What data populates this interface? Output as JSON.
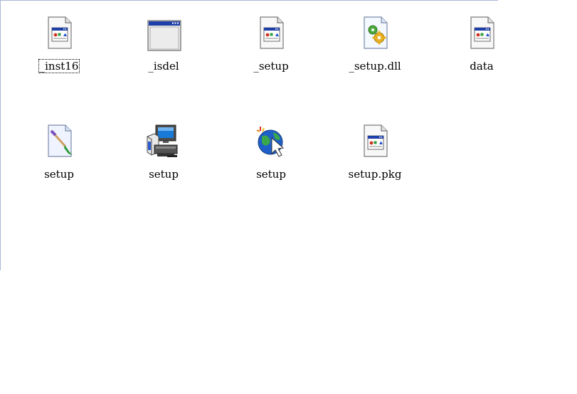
{
  "files": [
    {
      "label": "_inst16",
      "icon": "app-document-icon",
      "focused": true
    },
    {
      "label": "_isdel",
      "icon": "window-icon"
    },
    {
      "label": "_setup",
      "icon": "app-document-icon"
    },
    {
      "label": "_setup.dll",
      "icon": "dll-gear-icon"
    },
    {
      "label": "data",
      "icon": "app-document-icon"
    },
    {
      "label": "setup",
      "icon": "paint-brush-file-icon"
    },
    {
      "label": "setup",
      "icon": "computer-install-icon"
    },
    {
      "label": "setup",
      "icon": "globe-cursor-icon"
    },
    {
      "label": "setup.pkg",
      "icon": "app-document-icon"
    }
  ],
  "colors": {
    "window_border": "#a8b8d8",
    "title_blue": "#1f3fa8"
  }
}
